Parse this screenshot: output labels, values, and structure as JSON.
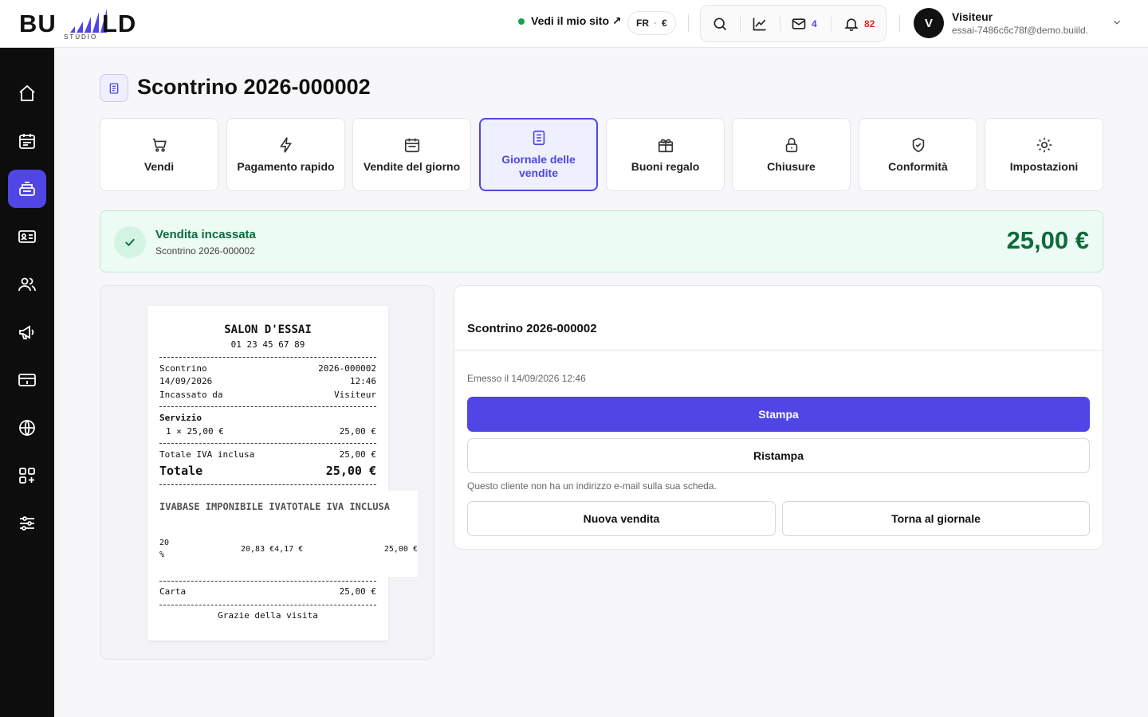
{
  "header": {
    "logo_text_left": "BU",
    "logo_text_right": "LD",
    "logo_sub": "STUDIO",
    "site_link": "Vedi il mio sito ↗",
    "lang": "FR",
    "currency": "€",
    "mail_count": "4",
    "notif_count": "82",
    "user": {
      "initial": "V",
      "name": "Visiteur",
      "email": "essai-7486c6c78f@demo.buiild...."
    }
  },
  "page": {
    "title": "Scontrino 2026-000002"
  },
  "tiles": [
    {
      "label": "Vendi",
      "icon": "cart-icon"
    },
    {
      "label": "Pagamento rapido",
      "icon": "lightning-icon"
    },
    {
      "label": "Vendite del giorno",
      "icon": "calendar-icon"
    },
    {
      "label": "Giornale delle vendite",
      "icon": "document-icon",
      "active": true
    },
    {
      "label": "Buoni regalo",
      "icon": "gift-icon"
    },
    {
      "label": "Chiusure",
      "icon": "lock-icon"
    },
    {
      "label": "Conformità",
      "icon": "shield-check-icon"
    },
    {
      "label": "Impostazioni",
      "icon": "gear-icon"
    }
  ],
  "banner": {
    "title": "Vendita incassata",
    "subtitle": "Scontrino 2026-000002",
    "amount": "25,00 €"
  },
  "receipt": {
    "shop": "SALON D'ESSAI",
    "phone": "01 23 45 67 89",
    "label_receipt": "Scontrino",
    "receipt_no": "2026-000002",
    "date": "14/09/2026",
    "time": "12:46",
    "label_cashier": "Incassato da",
    "cashier": "Visiteur",
    "section": "Servizio",
    "line_qty": "1 × 25,00 €",
    "line_total": "25,00 €",
    "label_vat_total": "Totale IVA inclusa",
    "vat_total": "25,00 €",
    "label_total": "Totale",
    "total": "25,00 €",
    "vat_header": "IVABASE IMPONIBILE  IVATOTALE IVA INCLUSA",
    "vat_rate_1": "20",
    "vat_rate_2": "%",
    "vat_base_amount": "20,83 €4,17 €",
    "vat_incl": "25,00 €",
    "label_card": "Carta",
    "card": "25,00 €",
    "thanks": "Grazie della visita"
  },
  "detail": {
    "title": "Scontrino 2026-000002",
    "issued": "Emesso il 14/09/2026 12:46",
    "print": "Stampa",
    "reprint": "Ristampa",
    "note": "Questo cliente non ha un indirizzo e-mail sulla sua scheda.",
    "new_sale": "Nuova vendita",
    "back": "Torna al giornale"
  },
  "colors": {
    "accent": "#4f46e5",
    "success": "#0b6b3c",
    "sidebar": "#0d0d0d"
  },
  "sidebar_icons": [
    "home-icon",
    "calendar-icon",
    "register-icon",
    "id-card-icon",
    "users-icon",
    "megaphone-icon",
    "card-icon",
    "globe-icon",
    "apps-icon",
    "sliders-icon"
  ]
}
